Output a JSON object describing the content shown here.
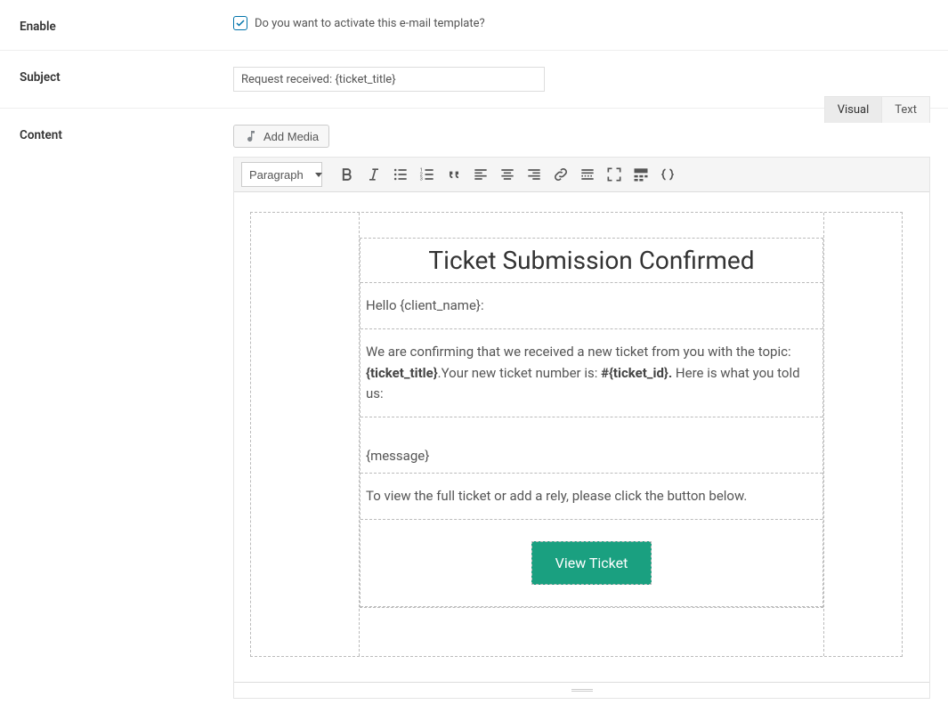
{
  "enable": {
    "label": "Enable",
    "checked": true,
    "text": "Do you want to activate this e-mail template?"
  },
  "subject": {
    "label": "Subject",
    "value": "Request received: {ticket_title}"
  },
  "content": {
    "label": "Content",
    "add_media": "Add Media",
    "tabs": {
      "visual": "Visual",
      "text": "Text",
      "active": "visual"
    },
    "format_select": "Paragraph",
    "template": {
      "heading": "Ticket Submission Confirmed",
      "greeting": "Hello {client_name}:",
      "p1_a": "We are confirming that we received a new ticket from you with the topic: ",
      "p1_b": "{ticket_title}",
      "p1_c": ".Your new ticket number is: ",
      "p1_d": "#{ticket_id}.",
      "p1_e": " Here is what you told us:",
      "message_ph": "{message}",
      "p2": "To view the full ticket or add a rely, please click the button below.",
      "cta": "View Ticket"
    }
  }
}
